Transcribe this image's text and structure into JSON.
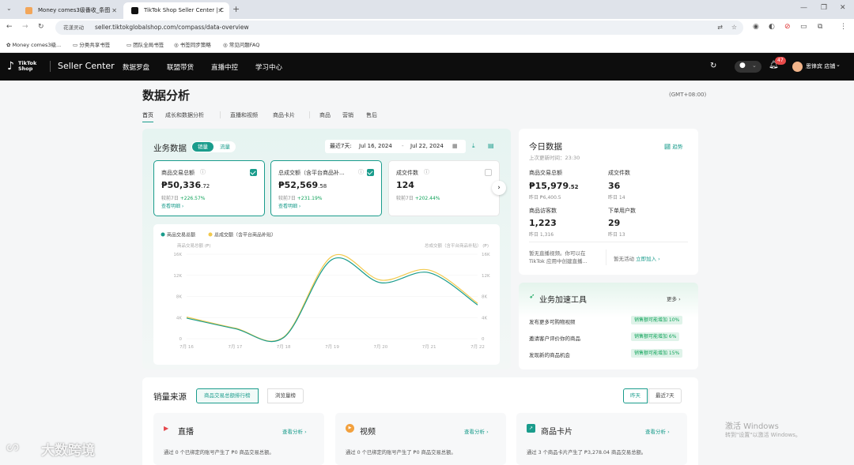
{
  "browser": {
    "tabs": [
      {
        "label": "Money comes3级番收_条图"
      },
      {
        "label": "TikTok Shop Seller Center | C"
      }
    ],
    "new_tab": "+",
    "url": "seller.tiktokglobalshop.com/compass/data-overview",
    "translate_label": "花漾灵动",
    "bookmarks": [
      "Money comes3级...",
      "分类共享书签",
      "团队全局书签",
      "书签同步策略",
      "常见问题FAQ"
    ]
  },
  "header": {
    "logo": "TikTok Shop",
    "brand": "Seller Center",
    "nav": [
      "数据罗盘",
      "联盟带货",
      "直播中控",
      "学习中心"
    ],
    "notification_count": "47",
    "shop_name": "思锋宾 店铺"
  },
  "page": {
    "title": "数据分析",
    "timezone": "(GMT+08:00)",
    "tabs": [
      "首页",
      "成长和数据分析",
      "直播和视频",
      "商品卡片",
      "商品",
      "营销",
      "售后"
    ]
  },
  "business": {
    "title": "业务数据",
    "toggle": [
      "销量",
      "流量"
    ],
    "range_label": "最近7天:",
    "date_from": "Jul 16, 2024",
    "date_sep": "-",
    "date_to": "Jul 22, 2024",
    "metrics": [
      {
        "title": "商品交易总额",
        "value": "₱50,336",
        "decimal": ".72",
        "cmp_label": "较前7日",
        "cmp": "+226.57%",
        "link": "查看明细 ›"
      },
      {
        "title": "总成交额（含平台商品补...",
        "value": "₱52,569",
        "decimal": ".58",
        "cmp_label": "较前7日",
        "cmp": "+231.19%",
        "link": "查看明细 ›"
      },
      {
        "title": "成交件数",
        "value": "124",
        "decimal": "",
        "cmp_label": "较前7日",
        "cmp": "+202.44%",
        "link": ""
      }
    ]
  },
  "chart_data": {
    "type": "line",
    "x": [
      "7月 16",
      "7月 17",
      "7月 18",
      "7月 19",
      "7月 20",
      "7月 21",
      "7月 22"
    ],
    "series": [
      {
        "name": "商品交易总额",
        "values": [
          3900,
          1900,
          200,
          15000,
          10600,
          12500,
          6400
        ]
      },
      {
        "name": "总成交额（含平台商品补贴）",
        "values": [
          4100,
          2000,
          300,
          15600,
          11100,
          13000,
          6700
        ]
      }
    ],
    "ylabel_left": "商品交易总额 (₱)",
    "ylabel_right": "总成交额（含平台商品补贴） (₱)",
    "ylim": [
      0,
      16000
    ],
    "yticks": [
      "0",
      "4K",
      "8K",
      "12K",
      "16K"
    ],
    "colors": [
      "#1a9c8c",
      "#f2c94c"
    ]
  },
  "today": {
    "title": "今日数据",
    "update_label": "上次更新时间：",
    "update_time": "23:30",
    "link": "趋势",
    "items": [
      {
        "label": "商品交易总额",
        "value": "₱15,979",
        "decimal": ".52",
        "sub": "昨日 ₱6,400.5"
      },
      {
        "label": "成交件数",
        "value": "36",
        "decimal": "",
        "sub": "昨日 14"
      },
      {
        "label": "商品访客数",
        "value": "1,223",
        "decimal": "",
        "sub": "昨日 1,316"
      },
      {
        "label": "下单用户数",
        "value": "29",
        "decimal": "",
        "sub": "昨日 13"
      }
    ],
    "live_note": "暂无直播视频。你可以在 TikTok 应用中创建直播...",
    "event_note": "暂无活动",
    "join_link": "立即加入 ›"
  },
  "boost": {
    "title": "业务加速工具",
    "more": "更多 ›",
    "items": [
      {
        "label": "发布更多可购物视频",
        "tag": "销售额可能增加 10%"
      },
      {
        "label": "邀请客户评价你的商品",
        "tag": "销售额可能增加 6%"
      },
      {
        "label": "发现新的商品机会",
        "tag": "销售额可能增加 15%"
      }
    ]
  },
  "sales": {
    "title": "销量来源",
    "tabs": [
      "商品交易总额排行榜",
      "浏览量榜"
    ],
    "range": [
      "昨天",
      "最近7天"
    ],
    "cards": [
      {
        "title": "直播",
        "link": "查看分析 ›",
        "desc": "通过 0 个已绑定的账号产生了 ₱0 商品交易总额。"
      },
      {
        "title": "视频",
        "link": "查看分析 ›",
        "desc": "通过 0 个已绑定的账号产生了 ₱0 商品交易总额。"
      },
      {
        "title": "商品卡片",
        "link": "查看分析 ›",
        "desc": "通过 3 个商品卡片产生了 ₱3,278.04 商品交易总额。"
      }
    ]
  },
  "overlay": {
    "activate_title": "激活 Windows",
    "activate_sub": "转到\"设置\"以激活 Windows。",
    "watermark": "大数跨境"
  }
}
